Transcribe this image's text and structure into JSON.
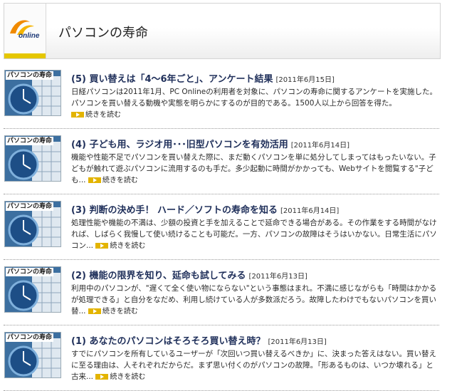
{
  "header": {
    "logo_text": "online",
    "title": "パソコンの寿命"
  },
  "colors": {
    "accent": "#e5c700",
    "title": "#1f2f5a",
    "thumb_bg": "#3c6fa0"
  },
  "articles": [
    {
      "thumb_label": "パソコンの寿命",
      "title": "(5) 買い替えは「4～6年ごと」、アンケート結果",
      "date": "[2011年6月15日]",
      "body": "日経パソコンは2011年1月、PC Onlineの利用者を対象に、パソコンの寿命に関するアンケートを実施した。パソコンを買い替える動機や実態を明らかにするのが目的である。1500人以上から回答を得た。",
      "more": "続きを読む"
    },
    {
      "thumb_label": "パソコンの寿命",
      "title": "(4) 子ども用、ラジオ用･･･旧型パソコンを有効活用",
      "date": "[2011年6月14日]",
      "body": "機能や性能不足でパソコンを買い替えた際に、まだ動くパソコンを単に処分してしまってはもったいない。子どもが触れて遊ぶパソコンに流用するのも手だ。多少起動に時間がかかっても、Webサイトを閲覧する\"子ども...",
      "more": "続きを読む"
    },
    {
      "thumb_label": "パソコンの寿命",
      "title": "(3) 判断の決め手！ ハード／ソフトの寿命を知る",
      "date": "[2011年6月14日]",
      "body": "処理性能や機能の不満は、少額の投資と手を加えることで延命できる場合がある。その作業をする時間がなければ、しばらく我慢して使い続けることも可能だ。一方、パソコンの故障はそうはいかない。日常生活にパソコン...",
      "more": "続きを読む"
    },
    {
      "thumb_label": "パソコンの寿命",
      "title": "(2) 機能の限界を知り、延命も試してみる",
      "date": "[2011年6月13日]",
      "body": "利用中のパソコンが、\"遅くて全く使い物にならない\"という事態はまれ。不満に感じながらも「時間はかかるが処理できる」と自分をなだめ、利用し続けている人が多数派だろう。故障したわけでもないパソコンを買い替...",
      "more": "続きを読む"
    },
    {
      "thumb_label": "パソコンの寿命",
      "title": "(1) あなたのパソコンはそろそろ買い替え時？",
      "date": "[2011年6月13日]",
      "body": "すでにパソコンを所有しているユーザーが「次回いつ買い替えるべきか」に、決まった答えはない。買い替えに至る理由は、人それぞれだからだ。まず思い付くのがパソコンの故障。「形あるものは、いつか壊れる」と古来...",
      "more": "続きを読む"
    }
  ]
}
